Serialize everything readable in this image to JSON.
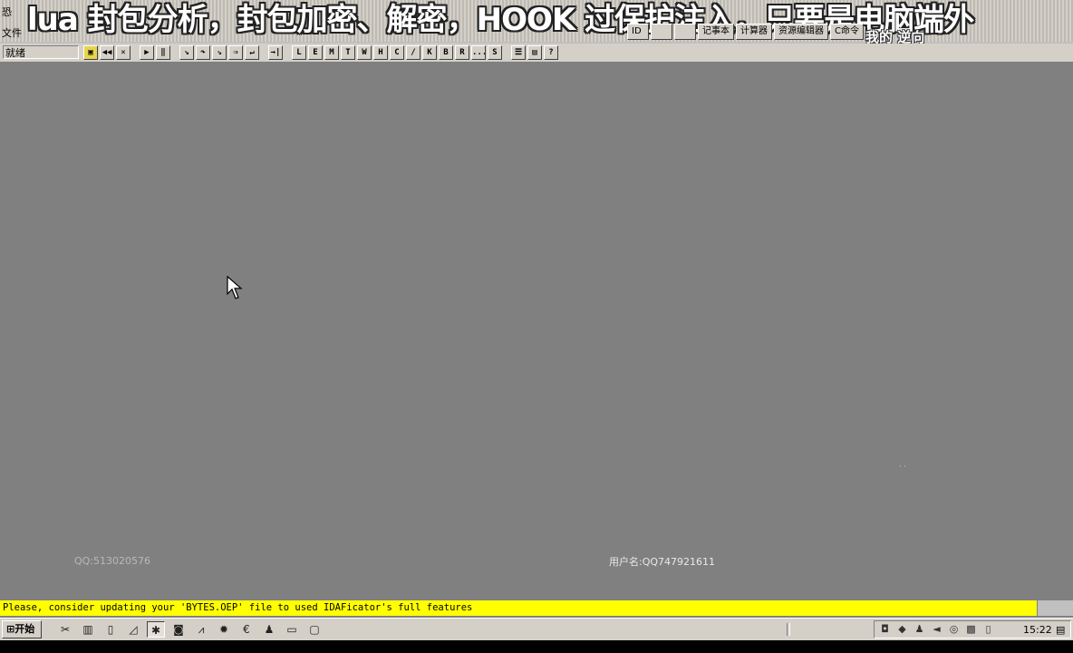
{
  "banner": {
    "text": "lua 封包分析，封包加密、解密，HOOK 过保护注入，只要是电脑端外"
  },
  "app": {
    "icon_text": "恐",
    "menu_file": "文件"
  },
  "top_buttons": [
    "ID",
    "",
    "",
    "记事本",
    "计算器",
    "资源编辑器",
    "C命令"
  ],
  "top_right_text": "我的 逆向",
  "toolbar": {
    "status_label": "就绪",
    "icons": [
      {
        "name": "open-file-icon",
        "glyph": "▣",
        "style": "yellow"
      },
      {
        "name": "rewind-icon",
        "glyph": "◀◀"
      },
      {
        "name": "close-icon",
        "glyph": "✕"
      },
      {
        "name": "gap"
      },
      {
        "name": "run-icon",
        "glyph": "▶"
      },
      {
        "name": "pause-icon",
        "glyph": "‖"
      },
      {
        "name": "gap"
      },
      {
        "name": "step-into-icon",
        "glyph": "↘"
      },
      {
        "name": "step-over-icon",
        "glyph": "↷"
      },
      {
        "name": "trace-into-icon",
        "glyph": "⇘"
      },
      {
        "name": "trace-over-icon",
        "glyph": "⇒"
      },
      {
        "name": "execute-till-return-icon",
        "glyph": "↵"
      },
      {
        "name": "gap"
      },
      {
        "name": "goto-icon",
        "glyph": "→|"
      },
      {
        "name": "gap"
      },
      {
        "name": "log-window-icon",
        "glyph": "L"
      },
      {
        "name": "executable-modules-icon",
        "glyph": "E"
      },
      {
        "name": "memory-map-icon",
        "glyph": "M"
      },
      {
        "name": "threads-icon",
        "glyph": "T"
      },
      {
        "name": "windows-icon",
        "glyph": "W"
      },
      {
        "name": "handles-icon",
        "glyph": "H"
      },
      {
        "name": "cpu-icon",
        "glyph": "C"
      },
      {
        "name": "patches-icon",
        "glyph": "/"
      },
      {
        "name": "call-stack-icon",
        "glyph": "K"
      },
      {
        "name": "breakpoints-icon",
        "glyph": "B"
      },
      {
        "name": "references-icon",
        "glyph": "R"
      },
      {
        "name": "run-trace-icon",
        "glyph": "..."
      },
      {
        "name": "source-icon",
        "glyph": "S"
      },
      {
        "name": "gap"
      },
      {
        "name": "options-icon",
        "glyph": "☰"
      },
      {
        "name": "appearance-icon",
        "glyph": "▤"
      },
      {
        "name": "help-icon",
        "glyph": "?"
      }
    ]
  },
  "main": {
    "qq_left": "QQ:513020576",
    "user_label": "用户名:QQ747921611",
    "dots": "· ·"
  },
  "message_bar": {
    "text": "Please, consider updating your 'BYTES.OEP' file to used IDAFicator's full features"
  },
  "taskbar": {
    "start_label": "开始",
    "quick_launch": [
      {
        "name": "tools-icon",
        "glyph": "✂"
      },
      {
        "name": "chart-icon",
        "glyph": "▥"
      },
      {
        "name": "document-icon",
        "glyph": "▯"
      },
      {
        "name": "folder-icon",
        "glyph": "◿"
      },
      {
        "name": "debugger-icon",
        "glyph": "✱",
        "active": true
      },
      {
        "name": "camera-icon",
        "glyph": "◙"
      },
      {
        "name": "network-icon",
        "glyph": "⩘"
      },
      {
        "name": "bug-icon",
        "glyph": "✹"
      },
      {
        "name": "euro-icon",
        "glyph": "€"
      },
      {
        "name": "user-icon",
        "glyph": "♟"
      },
      {
        "name": "monitor-icon",
        "glyph": "▭"
      },
      {
        "name": "notepad-icon",
        "glyph": "▢"
      }
    ],
    "tray_icons": [
      {
        "name": "camera-tray-icon",
        "glyph": "◘"
      },
      {
        "name": "shield-tray-icon",
        "glyph": "◆"
      },
      {
        "name": "penguin-tray-icon",
        "glyph": "♟"
      },
      {
        "name": "volume-tray-icon",
        "glyph": "◄"
      },
      {
        "name": "security-tray-icon",
        "glyph": "◎"
      },
      {
        "name": "network-tray-icon",
        "glyph": "▩"
      },
      {
        "name": "speaker-tray-icon",
        "glyph": "▯"
      }
    ],
    "clock": "15:22",
    "keyboard_glyph": "▤"
  }
}
